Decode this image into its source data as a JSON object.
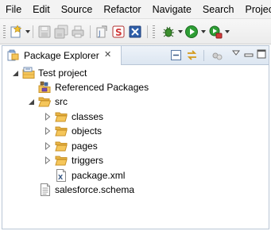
{
  "menu": [
    "File",
    "Edit",
    "Source",
    "Refactor",
    "Navigate",
    "Search",
    "Project"
  ],
  "toolbar": {
    "icons": [
      "new-wizard-icon",
      "save-icon",
      "save-all-icon",
      "print-icon",
      "open-type-icon",
      "salesforce-icon",
      "close-icon",
      "debug-icon",
      "run-icon",
      "external-tools-icon"
    ]
  },
  "view": {
    "title": "Package Explorer",
    "close_glyph": "✕"
  },
  "tree": {
    "project": "Test project",
    "referenced": "Referenced Packages",
    "src": "src",
    "classes": "classes",
    "objects": "objects",
    "pages": "pages",
    "triggers": "triggers",
    "package_xml": "package.xml",
    "schema": "salesforce.schema"
  },
  "colors": {
    "folder": "#f5c65a",
    "folder_dark": "#c9932a",
    "run": "#2e9e35",
    "debug": "#3c8f2e",
    "accent_red": "#d23a3a"
  }
}
